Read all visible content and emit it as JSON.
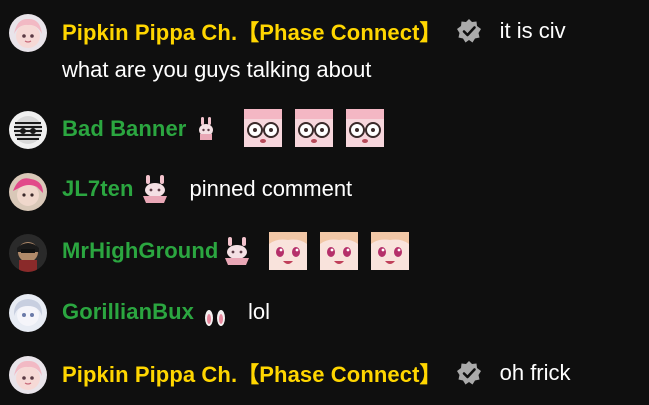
{
  "messages": [
    {
      "author": "Pipkin Pippa Ch.【Phase Connect】",
      "text_line1": "it is civ",
      "text_line2": "what are you guys talking about",
      "verified_icon": "verified-check-icon"
    },
    {
      "author": "Bad Banner",
      "badge_icon": "bunny-member-badge-icon",
      "emotes": [
        "shocked-emote",
        "shocked-emote",
        "shocked-emote"
      ]
    },
    {
      "author": "JL7ten",
      "badge_icon": "bunny-member-badge-icon",
      "text": "pinned comment"
    },
    {
      "author": "MrHighGround",
      "badge_icon": "bunny-member-badge-icon",
      "emotes": [
        "happy-emote",
        "happy-emote",
        "happy-emote"
      ]
    },
    {
      "author": "GorillianBux",
      "badge_icon": "bunny-ears-member-badge-icon",
      "text": "lol"
    },
    {
      "author": "Pipkin Pippa Ch.【Phase Connect】",
      "text": "oh frick",
      "verified_icon": "verified-check-icon"
    }
  ],
  "colors": {
    "background": "#0f0f0f",
    "owner_name": "#ffd600",
    "member_name": "#2ba640",
    "message_text": "#ffffff",
    "verified_badge": "#aaaaaa"
  }
}
